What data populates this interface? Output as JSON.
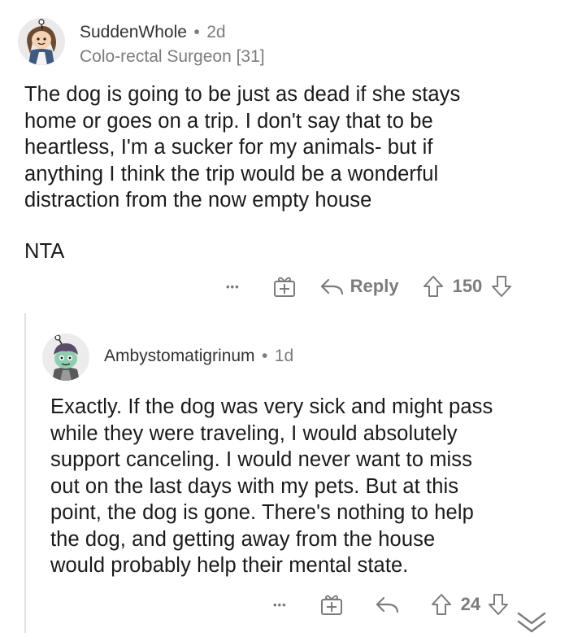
{
  "comments": [
    {
      "username": "SuddenWhole",
      "age": "2d",
      "flair": "Colo-rectal Surgeon [31]",
      "body_lines": [
        "The dog is going to be just as dead if she stays",
        "home or goes on a trip. I don't say that to be",
        "heartless, I'm a sucker for my animals- but if",
        "anything I think the trip would be a wonderful",
        "distraction from the now empty house"
      ],
      "body_tail": "NTA",
      "reply_label": "Reply",
      "score": "150"
    },
    {
      "username": "Ambystomatigrinum",
      "age": "1d",
      "body_lines": [
        "Exactly. If the dog was very sick and might pass",
        "while they were traveling, I would absolutely",
        "support canceling. I would never want to miss",
        "out on the last days with my pets. But at this",
        "point, the dog is gone. There's nothing to help",
        "the dog, and getting away from the house",
        "would probably help their mental state."
      ],
      "score": "24"
    }
  ],
  "dot_separator": "•",
  "more_glyph": "•••",
  "icons": [
    "more-icon",
    "award-icon",
    "reply-icon",
    "upvote-icon",
    "downvote-icon",
    "collapse-chevron-icon"
  ]
}
